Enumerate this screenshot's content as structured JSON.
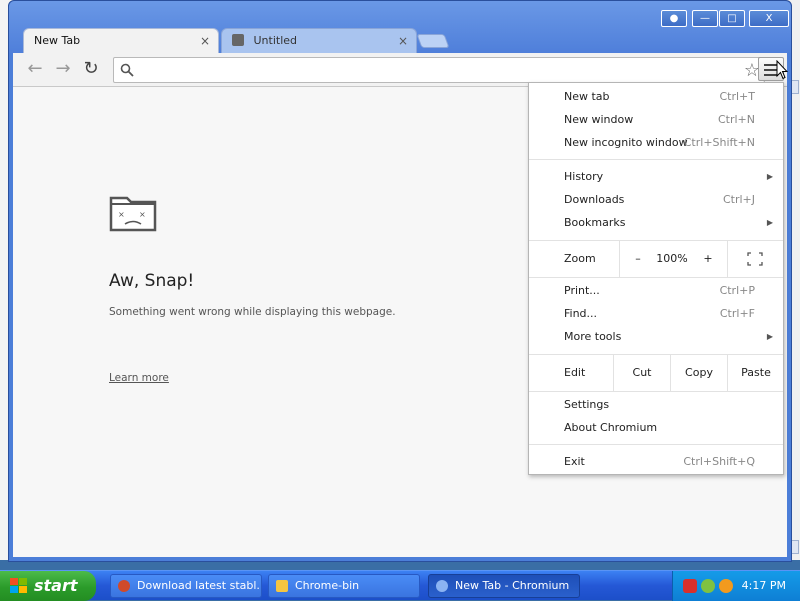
{
  "window": {
    "tabs": [
      {
        "label": "New Tab",
        "close": "×"
      },
      {
        "label": "Untitled",
        "close": "×"
      }
    ],
    "controls": {
      "user": "👤",
      "minimize": "—",
      "maximize": "□",
      "close": "X"
    }
  },
  "toolbar": {
    "search": {
      "value": "",
      "placeholder": ""
    }
  },
  "page": {
    "title": "Aw, Snap!",
    "message": "Something went wrong while displaying this webpage.",
    "learn_more": "Learn more"
  },
  "menu": {
    "group1": [
      {
        "label": "New tab",
        "shortcut": "Ctrl+T"
      },
      {
        "label": "New window",
        "shortcut": "Ctrl+N"
      },
      {
        "label": "New incognito window",
        "shortcut": "Ctrl+Shift+N"
      }
    ],
    "group2": [
      {
        "label": "History",
        "submenu": true
      },
      {
        "label": "Downloads",
        "shortcut": "Ctrl+J"
      },
      {
        "label": "Bookmarks",
        "submenu": true
      }
    ],
    "zoom": {
      "label": "Zoom",
      "minus": "–",
      "value": "100%",
      "plus": "+"
    },
    "group3": [
      {
        "label": "Print...",
        "shortcut": "Ctrl+P"
      },
      {
        "label": "Find...",
        "shortcut": "Ctrl+F"
      },
      {
        "label": "More tools",
        "submenu": true
      }
    ],
    "edit": {
      "label": "Edit",
      "cut": "Cut",
      "copy": "Copy",
      "paste": "Paste"
    },
    "group4": [
      {
        "label": "Settings"
      },
      {
        "label": "About Chromium"
      }
    ],
    "exit": {
      "label": "Exit",
      "shortcut": "Ctrl+Shift+Q"
    }
  },
  "taskbar": {
    "start": "start",
    "buttons": [
      {
        "label": "Download latest stabl...",
        "icon": "globe-icon"
      },
      {
        "label": "Chrome-bin",
        "icon": "folder-icon"
      },
      {
        "label": "New Tab - Chromium",
        "icon": "chromium-icon",
        "active": true
      }
    ],
    "clock": "4:17 PM"
  },
  "colors": {
    "taskbar_blue": "#2558d6",
    "start_green": "#2b9b2a",
    "frame_blue": "#4f7fda"
  }
}
